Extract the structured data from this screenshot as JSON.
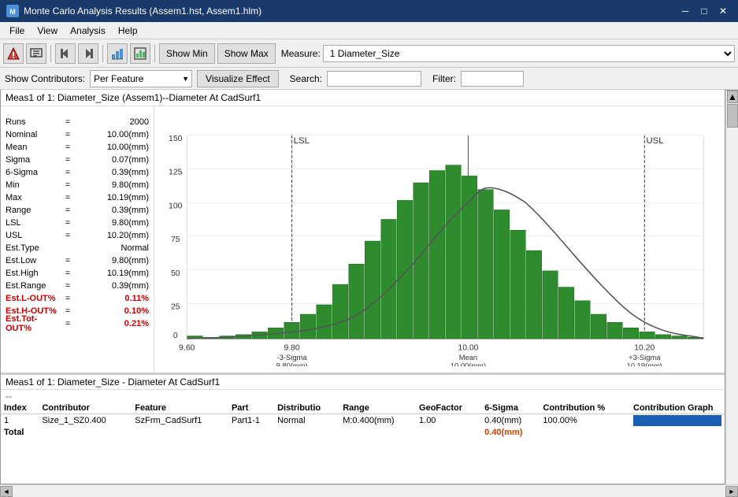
{
  "titleBar": {
    "icon": "mc-icon",
    "title": "Monte Carlo Analysis Results (Assem1.hst, Assem1.hlm)",
    "minimizeLabel": "─",
    "maximizeLabel": "□",
    "closeLabel": "✕"
  },
  "menuBar": {
    "items": [
      "File",
      "View",
      "Analysis",
      "Help"
    ]
  },
  "toolbar": {
    "showMinLabel": "Show Min",
    "showMaxLabel": "Show Max",
    "measureLabel": "Measure:",
    "measureValue": "1 Diameter_Size"
  },
  "contributorsBar": {
    "showContributorsLabel": "Show Contributors:",
    "perFeatureOption": "Per Feature",
    "visualizeEffectLabel": "Visualize Effect",
    "searchLabel": "Search:",
    "filterLabel": "Filter:"
  },
  "sectionHeader": {
    "text": "Meas1 of 1: Diameter_Size (Assem1)--Diameter At CadSurf1"
  },
  "stats": [
    {
      "label": "Runs",
      "eq": "=",
      "val": "2000"
    },
    {
      "label": "Nominal",
      "eq": "=",
      "val": "10.00(mm)"
    },
    {
      "label": "Mean",
      "eq": "=",
      "val": "10.00(mm)"
    },
    {
      "label": "Sigma",
      "eq": "=",
      "val": "0.07(mm)"
    },
    {
      "label": "6-Sigma",
      "eq": "=",
      "val": "0.39(mm)"
    },
    {
      "label": "Min",
      "eq": "=",
      "val": "9.80(mm)"
    },
    {
      "label": "Max",
      "eq": "=",
      "val": "10.19(mm)"
    },
    {
      "label": "Range",
      "eq": "=",
      "val": "0.39(mm)"
    },
    {
      "label": "LSL",
      "eq": "=",
      "val": "9.80(mm)"
    },
    {
      "label": "USL",
      "eq": "=",
      "val": "10.20(mm)"
    },
    {
      "label": "Est.Type",
      "eq": "",
      "val": "Normal"
    },
    {
      "label": "Est.Low",
      "eq": "=",
      "val": "9.80(mm)"
    },
    {
      "label": "Est.High",
      "eq": "=",
      "val": "10.19(mm)"
    },
    {
      "label": "Est.Range",
      "eq": "=",
      "val": "0.39(mm)"
    },
    {
      "label": "Est.L-OUT%",
      "eq": "=",
      "val": "0.11%",
      "red": true
    },
    {
      "label": "Est.H-OUT%",
      "eq": "=",
      "val": "0.10%",
      "red": true
    },
    {
      "label": "Est.Tot-OUT%",
      "eq": "=",
      "val": "0.21%",
      "red": true
    }
  ],
  "chart": {
    "lslLabel": "LSL",
    "uslLabel": "USL",
    "xAxisLabels": [
      "9.60",
      "9.80",
      "10.00",
      "10.20"
    ],
    "sigmaLabels": [
      "-3-Sigma\n9.80(mm)",
      "Mean\n10.00(mm)",
      "+3-Sigma\n10.19(mm)"
    ],
    "yAxisLabels": [
      "0",
      "25",
      "50",
      "75",
      "100",
      "125",
      "150"
    ],
    "bars": [
      2,
      1,
      2,
      3,
      5,
      8,
      12,
      18,
      25,
      40,
      55,
      72,
      88,
      102,
      115,
      124,
      128,
      120,
      110,
      95,
      80,
      65,
      50,
      38,
      28,
      18,
      12,
      8,
      5,
      3,
      2,
      1
    ]
  },
  "bottomSection": {
    "header": "Meas1 of 1: Diameter_Size - Diameter At CadSurf1",
    "dash": "--",
    "columns": [
      "Index",
      "Contributor",
      "Feature",
      "Part",
      "Distributio",
      "Range",
      "GeoFactor",
      "6-Sigma",
      "Contribution %",
      "Contribution Graph"
    ],
    "rows": [
      {
        "index": "1",
        "contributor": "Size_1_SZ0.400",
        "feature": "SzFrm_CadSurf1",
        "part": "Part1-1",
        "distribution": "Normal",
        "range": "M:0.400(mm)",
        "geoFactor": "1.00",
        "sixSigma": "0.40(mm)",
        "contributionPct": "100.00%",
        "barWidth": 100
      }
    ],
    "totalRow": {
      "label": "Total",
      "sixSigma": "0.40(mm)"
    }
  }
}
